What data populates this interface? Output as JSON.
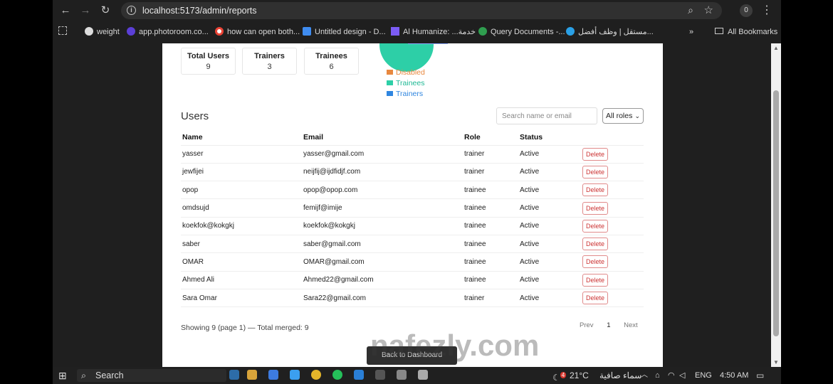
{
  "browser": {
    "url": "localhost:5173/admin/reports",
    "profile_initial": "0",
    "bookmarks": [
      "weight",
      "app.photoroom.co...",
      "how can open both...",
      "Untitled design - D...",
      "Al Humanize: ...خدمة",
      "Query Documents -...",
      "مستقل | وظف أفضل...",
      "All Bookmarks"
    ],
    "more_bookmarks": "»"
  },
  "stats": [
    {
      "title": "Total Users",
      "value": "9"
    },
    {
      "title": "Trainers",
      "value": "3"
    },
    {
      "title": "Trainees",
      "value": "6"
    }
  ],
  "legend": [
    {
      "label": "Disabled",
      "color": "#e8883f"
    },
    {
      "label": "Trainees",
      "color": "#2dcfa7"
    },
    {
      "label": "Trainers",
      "color": "#2f86e0"
    }
  ],
  "users": {
    "title": "Users",
    "search_placeholder": "Search name or email",
    "role_filter": "All roles",
    "headers": {
      "name": "Name",
      "email": "Email",
      "role": "Role",
      "status": "Status"
    },
    "delete_label": "Delete",
    "rows": [
      {
        "name": "yasser",
        "email": "yasser@gmail.com",
        "role": "trainer",
        "status": "Active"
      },
      {
        "name": "jewfijei",
        "email": "neijfij@ijdfidjf.com",
        "role": "trainer",
        "status": "Active"
      },
      {
        "name": "opop",
        "email": "opop@opop.com",
        "role": "trainee",
        "status": "Active"
      },
      {
        "name": "omdsujd",
        "email": "femijf@imije",
        "role": "trainee",
        "status": "Active"
      },
      {
        "name": "koekfok@kokgkj",
        "email": "koekfok@kokgkj",
        "role": "trainee",
        "status": "Active"
      },
      {
        "name": "saber",
        "email": "saber@gmail.com",
        "role": "trainee",
        "status": "Active"
      },
      {
        "name": "OMAR",
        "email": "OMAR@gmail.com",
        "role": "trainee",
        "status": "Active"
      },
      {
        "name": "Ahmed Ali",
        "email": "Ahmed22@gmail.com",
        "role": "trainee",
        "status": "Active"
      },
      {
        "name": "Sara Omar",
        "email": "Sara22@gmail.com",
        "role": "trainer",
        "status": "Active"
      }
    ],
    "summary": "Showing 9 (page 1) — Total merged: 9",
    "pager": {
      "prev": "Prev",
      "page": "1",
      "next": "Next"
    }
  },
  "back_button": "Back to Dashboard",
  "taskbar": {
    "search": "Search",
    "temperature": "21°C",
    "weather": "سماء صافية",
    "weather_badge": "4",
    "language": "ENG",
    "time": "4:50 AM"
  },
  "watermark": "nafezly.com"
}
